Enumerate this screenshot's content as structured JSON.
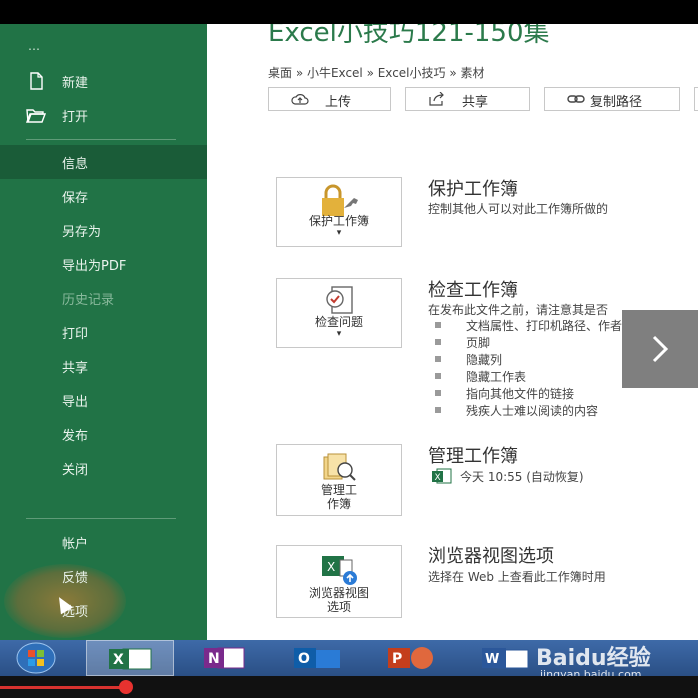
{
  "window": {
    "doc_title": "Excel小技巧121-150集",
    "breadcrumb": "桌面 » 小牛Excel » Excel小技巧 » 素材"
  },
  "sidebar": {
    "back_label": "⋯",
    "top_items": [
      {
        "label": "新建",
        "icon": "new-document-icon"
      },
      {
        "label": "打开",
        "icon": "open-folder-icon"
      }
    ],
    "items": [
      {
        "label": "信息",
        "state": "active"
      },
      {
        "label": "保存",
        "state": "normal"
      },
      {
        "label": "另存为",
        "state": "normal"
      },
      {
        "label": "导出为PDF",
        "state": "normal"
      },
      {
        "label": "历史记录",
        "state": "disabled"
      },
      {
        "label": "打印",
        "state": "normal"
      },
      {
        "label": "共享",
        "state": "normal"
      },
      {
        "label": "导出",
        "state": "normal"
      },
      {
        "label": "发布",
        "state": "normal"
      },
      {
        "label": "关闭",
        "state": "normal"
      }
    ],
    "bottom_items": [
      {
        "label": "帐户"
      },
      {
        "label": "反馈"
      },
      {
        "label": "选项"
      }
    ]
  },
  "toolbar": {
    "upload_label": "上传",
    "share_label": "共享",
    "copy_path_label": "复制路径"
  },
  "sections": {
    "protect": {
      "tile_label": "保护工作簿",
      "title": "保护工作簿",
      "desc": "控制其他人可以对此工作簿所做的"
    },
    "inspect": {
      "tile_label": "检查问题",
      "title": "检查工作簿",
      "desc": "在发布此文件之前，请注意其是否",
      "bullets": [
        "文档属性、打印机路径、作者",
        "页脚",
        "隐藏列",
        "隐藏工作表",
        "指向其他文件的链接",
        "残疾人士难以阅读的内容"
      ]
    },
    "manage": {
      "tile_label_1": "管理工",
      "tile_label_2": "作簿",
      "title": "管理工作簿",
      "autosave": "今天 10:55 (自动恢复)"
    },
    "browser": {
      "tile_label_1": "浏览器视图",
      "tile_label_2": "选项",
      "title": "浏览器视图选项",
      "desc": "选择在 Web 上查看此工作簿时用"
    }
  },
  "taskbar": {
    "apps": [
      "start",
      "excel",
      "onenote",
      "outlook",
      "powerpoint",
      "word"
    ],
    "active_app": "excel"
  },
  "watermark": {
    "brand": "Baidu经验",
    "url": "jingyan.baidu.com"
  },
  "video": {
    "progress_fraction": 0.18
  },
  "colors": {
    "sidebar": "#217346",
    "sidebar_active": "#1a5c38",
    "accent_title": "#2b7a4b"
  }
}
